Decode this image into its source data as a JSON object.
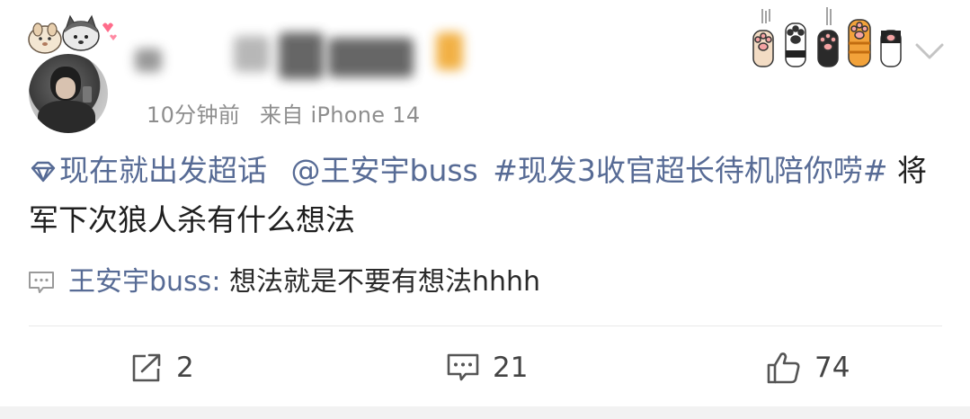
{
  "post": {
    "author_name": "",
    "time": "10分钟前",
    "source": "来自 iPhone 14",
    "content": {
      "super_topic": "现在就出发超话",
      "mention": "@王安宇buss",
      "hashtag_part1": "#现发3收官超长待机陪你",
      "hashtag_part2": "唠#",
      "text": " 将军下次狼人杀有什么想法"
    },
    "comment_preview": {
      "author": "王安宇buss:",
      "text": " 想法就是不要有想法hhhh"
    },
    "actions": {
      "repost_count": "2",
      "comment_count": "21",
      "like_count": "74"
    }
  },
  "colors": {
    "link": "#576b95",
    "text": "#1f1f1f",
    "meta": "#8e8e8e",
    "icon": "#555555"
  },
  "icons": {
    "super_topic": "diamond-icon",
    "comment_preview": "comment-bubble-icon",
    "repost": "repost-icon",
    "comment": "comment-icon",
    "like": "thumbs-up-icon",
    "more": "chevron-down-icon"
  }
}
